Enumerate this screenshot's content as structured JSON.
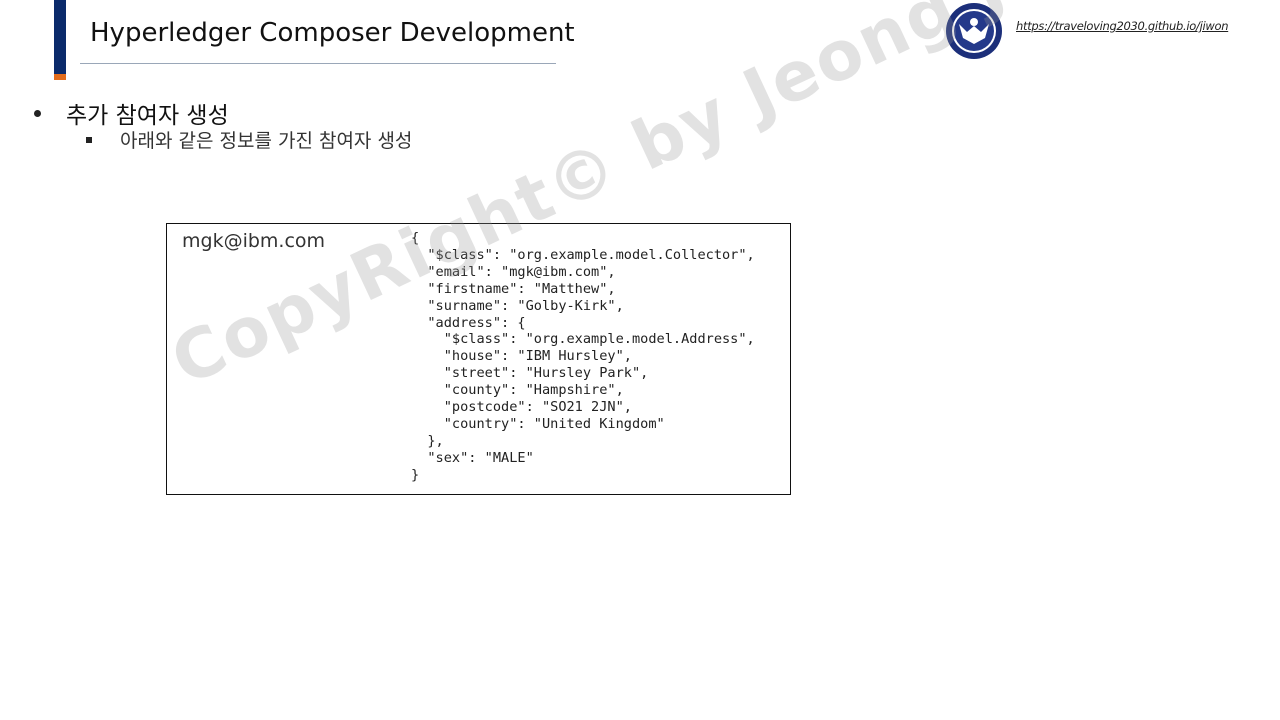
{
  "header": {
    "title": "Hyperledger Composer Development",
    "url": "https://traveloving2030.github.io/jiwon"
  },
  "content": {
    "bullet_1": "추가 참여자 생성",
    "bullet_1_sub": "아래와 같은 정보를 가진 참여자 생성"
  },
  "code_box": {
    "participant_id": "mgk@ibm.com",
    "json_lines": [
      "{",
      "  \"$class\": \"org.example.model.Collector\",",
      "  \"email\": \"mgk@ibm.com\",",
      "  \"firstname\": \"Matthew\",",
      "  \"surname\": \"Golby-Kirk\",",
      "  \"address\": {",
      "    \"$class\": \"org.example.model.Address\",",
      "    \"house\": \"IBM Hursley\",",
      "    \"street\": \"Hursley Park\",",
      "    \"county\": \"Hampshire\",",
      "    \"postcode\": \"SO21 2JN\",",
      "    \"country\": \"United Kingdom\"",
      "  },",
      "  \"sex\": \"MALE\"",
      "}"
    ]
  },
  "watermark": "CopyRight© by Jeong JiWon",
  "colors": {
    "accent_navy": "#0b2a6b",
    "accent_orange": "#e36c1b"
  }
}
